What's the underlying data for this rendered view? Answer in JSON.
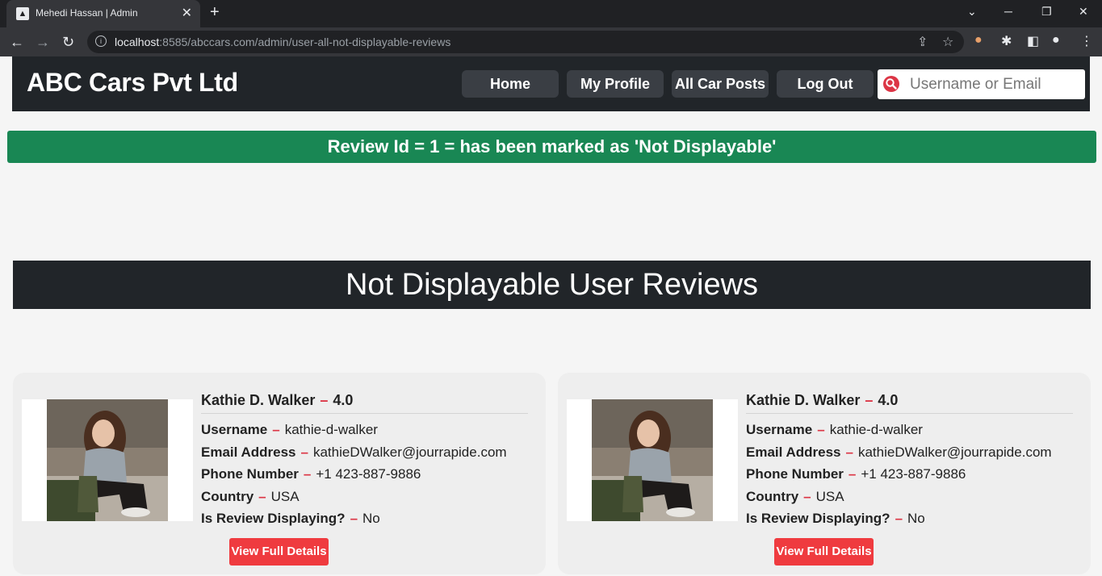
{
  "browser": {
    "tab_title": "Mehedi Hassan | Admin",
    "url_host": "localhost",
    "url_rest": ":8585/abccars.com/admin/user-all-not-displayable-reviews"
  },
  "header": {
    "brand": "ABC Cars Pvt Ltd",
    "nav": [
      "Home",
      "My Profile",
      "All Car Posts",
      "Log Out"
    ],
    "search_placeholder": "Username or Email"
  },
  "alert": {
    "message": "Review Id = 1 = has been marked as 'Not Displayable'"
  },
  "section": {
    "title": "Not Displayable User Reviews"
  },
  "labels": {
    "username": "Username",
    "email": "Email Address",
    "phone": "Phone Number",
    "country": "Country",
    "displaying": "Is Review Displaying?",
    "button": "View Full Details"
  },
  "reviews": [
    {
      "name": "Kathie D. Walker",
      "rating": "4.0",
      "username": "kathie-d-walker",
      "email": "kathieDWalker@jourrapide.com",
      "phone": "+1 423-887-9886",
      "country": "USA",
      "displaying": "No"
    },
    {
      "name": "Kathie D. Walker",
      "rating": "4.0",
      "username": "kathie-d-walker",
      "email": "kathieDWalker@jourrapide.com",
      "phone": "+1 423-887-9886",
      "country": "USA",
      "displaying": "No"
    }
  ],
  "colors": {
    "header_bg": "#212529",
    "alert_bg": "#198754",
    "accent_dash": "#dc3545",
    "button_bg": "#ef3b3f"
  }
}
